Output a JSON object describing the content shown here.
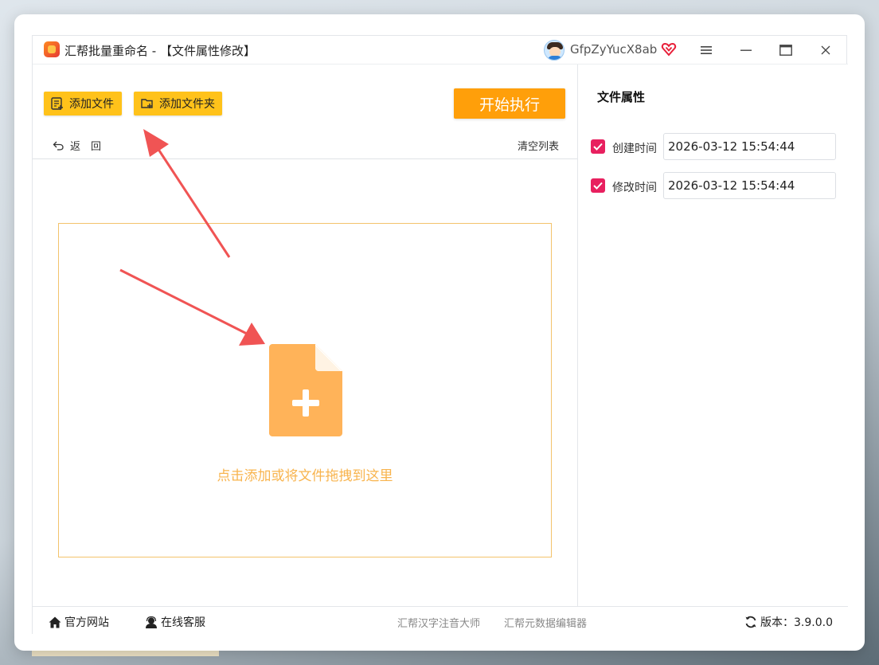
{
  "window": {
    "title": "汇帮批量重命名 - 【文件属性修改】",
    "username": "GfpZyYucX8ab"
  },
  "toolbar": {
    "add_file_label": "添加文件",
    "add_folder_label": "添加文件夹",
    "start_label": "开始执行",
    "back_label": "返　回",
    "clear_label": "清空列表"
  },
  "dropzone": {
    "hint": "点击添加或将文件拖拽到这里"
  },
  "properties": {
    "title": "文件属性",
    "items": [
      {
        "label": "创建时间",
        "value": "2026-03-12 15:54:44",
        "checked": true
      },
      {
        "label": "修改时间",
        "value": "2026-03-12 15:54:44",
        "checked": true
      }
    ]
  },
  "statusbar": {
    "website_label": "官方网站",
    "support_label": "在线客服",
    "link1_label": "汇帮汉字注音大师",
    "link2_label": "汇帮元数据编辑器",
    "version_label": "版本：3.9.0.0"
  },
  "colors": {
    "accent": "#ff9f0a",
    "button_yellow": "#ffc21a",
    "checkbox": "#e8205f",
    "drop_border": "#f3c36c",
    "drop_icon": "#ffb359",
    "annotation_arrow": "#f05454"
  },
  "icons": {
    "minimize": "minimize-icon",
    "maximize": "maximize-icon",
    "close": "close-icon",
    "menu": "menu-icon",
    "vip": "diamond-heart-icon"
  }
}
